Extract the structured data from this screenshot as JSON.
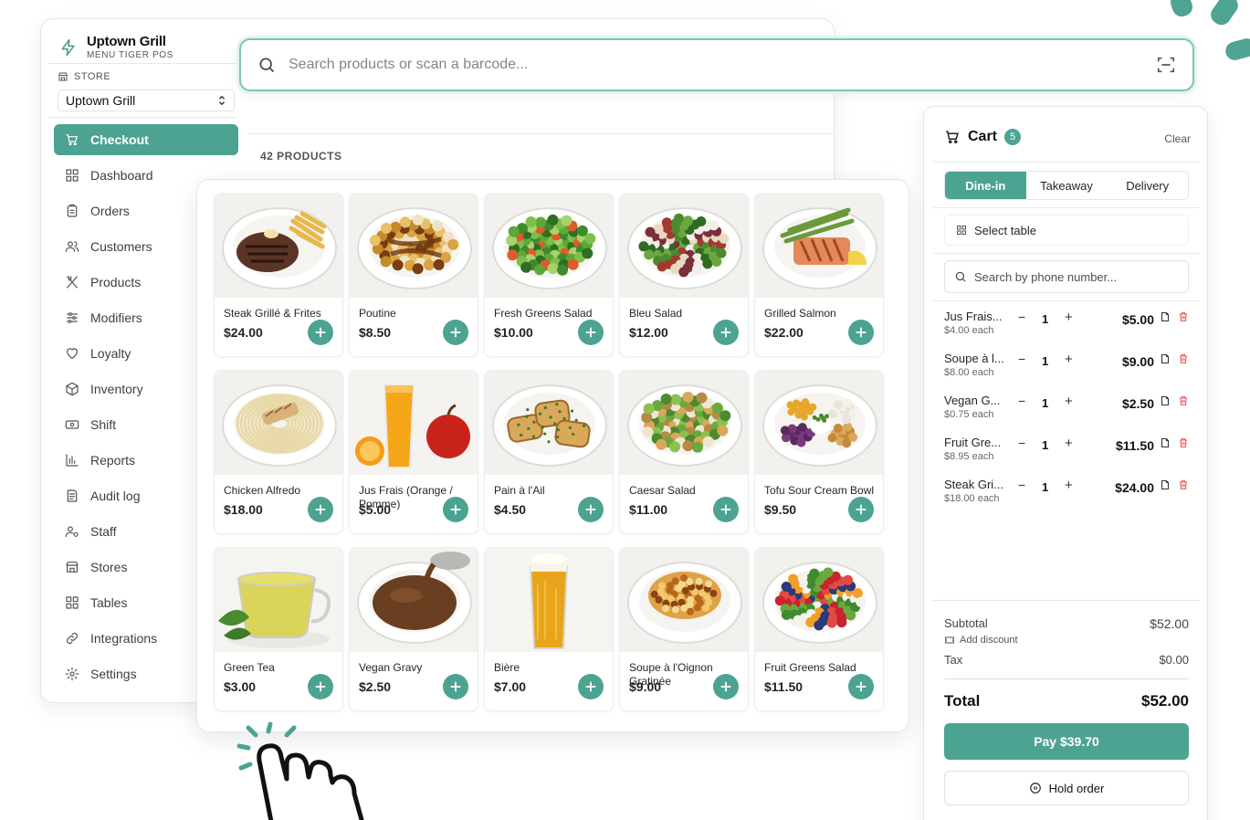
{
  "brand": {
    "name": "Uptown Grill",
    "subtitle": "MENU TIGER POS"
  },
  "store": {
    "label": "STORE",
    "selected": "Uptown Grill"
  },
  "nav": [
    {
      "label": "Checkout",
      "icon": "cart-icon",
      "active": true
    },
    {
      "label": "Dashboard",
      "icon": "grid-icon"
    },
    {
      "label": "Orders",
      "icon": "clipboard-icon"
    },
    {
      "label": "Customers",
      "icon": "users-icon"
    },
    {
      "label": "Products",
      "icon": "utensils-icon"
    },
    {
      "label": "Modifiers",
      "icon": "sliders-icon"
    },
    {
      "label": "Loyalty",
      "icon": "heart-icon"
    },
    {
      "label": "Inventory",
      "icon": "box-icon"
    },
    {
      "label": "Shift",
      "icon": "cash-icon"
    },
    {
      "label": "Reports",
      "icon": "bar-chart-icon"
    },
    {
      "label": "Audit log",
      "icon": "log-icon"
    },
    {
      "label": "Staff",
      "icon": "staff-icon"
    },
    {
      "label": "Stores",
      "icon": "store-icon"
    },
    {
      "label": "Tables",
      "icon": "tables-icon"
    },
    {
      "label": "Integrations",
      "icon": "link-icon"
    },
    {
      "label": "Settings",
      "icon": "gear-icon"
    }
  ],
  "search": {
    "placeholder": "Search products or scan a barcode..."
  },
  "products_count": "42 PRODUCTS",
  "products": [
    {
      "name": "Steak Grillé & Frites",
      "price": "$24.00",
      "image": "steak-frites"
    },
    {
      "name": "Poutine",
      "price": "$8.50",
      "image": "poutine"
    },
    {
      "name": "Fresh Greens Salad",
      "price": "$10.00",
      "image": "greens-salad"
    },
    {
      "name": "Bleu Salad",
      "price": "$12.00",
      "image": "bleu-salad"
    },
    {
      "name": "Grilled Salmon",
      "price": "$22.00",
      "image": "salmon"
    },
    {
      "name": "Chicken Alfredo",
      "price": "$18.00",
      "image": "alfredo"
    },
    {
      "name": "Jus Frais (Orange / Pomme)",
      "price": "$5.00",
      "image": "juice"
    },
    {
      "name": "Pain à l'Ail",
      "price": "$4.50",
      "image": "garlic-bread"
    },
    {
      "name": "Caesar Salad",
      "price": "$11.00",
      "image": "caesar"
    },
    {
      "name": "Tofu Sour Cream Bowl",
      "price": "$9.50",
      "image": "tofu-bowl"
    },
    {
      "name": "Green Tea",
      "price": "$3.00",
      "image": "green-tea"
    },
    {
      "name": "Vegan Gravy",
      "price": "$2.50",
      "image": "gravy"
    },
    {
      "name": "Bière",
      "price": "$7.00",
      "image": "beer"
    },
    {
      "name": "Soupe à l'Oignon Gratinée",
      "price": "$9.00",
      "image": "onion-soup"
    },
    {
      "name": "Fruit Greens Salad",
      "price": "$11.50",
      "image": "fruit-salad"
    }
  ],
  "cart": {
    "title": "Cart",
    "count": "5",
    "clear": "Clear",
    "tabs": [
      "Dine-in",
      "Takeaway",
      "Delivery"
    ],
    "active_tab": "Dine-in",
    "select_table": "Select table",
    "phone_placeholder": "Search by phone number...",
    "items": [
      {
        "name": "Jus Frais...",
        "each": "$4.00 each",
        "qty": "1",
        "price": "$5.00"
      },
      {
        "name": "Soupe à l...",
        "each": "$8.00 each",
        "qty": "1",
        "price": "$9.00"
      },
      {
        "name": "Vegan G...",
        "each": "$0.75 each",
        "qty": "1",
        "price": "$2.50"
      },
      {
        "name": "Fruit Gre...",
        "each": "$8.95 each",
        "qty": "1",
        "price": "$11.50"
      },
      {
        "name": "Steak Gri...",
        "each": "$18.00 each",
        "qty": "1",
        "price": "$24.00"
      }
    ],
    "subtotal_label": "Subtotal",
    "subtotal": "$52.00",
    "add_discount": "Add discount",
    "tax_label": "Tax",
    "tax": "$0.00",
    "total_label": "Total",
    "total": "$52.00",
    "pay": "Pay $39.70",
    "hold": "Hold order"
  },
  "colors": {
    "accent": "#4da392",
    "accent_light": "#e4f3ef",
    "danger": "#e05b5b"
  }
}
